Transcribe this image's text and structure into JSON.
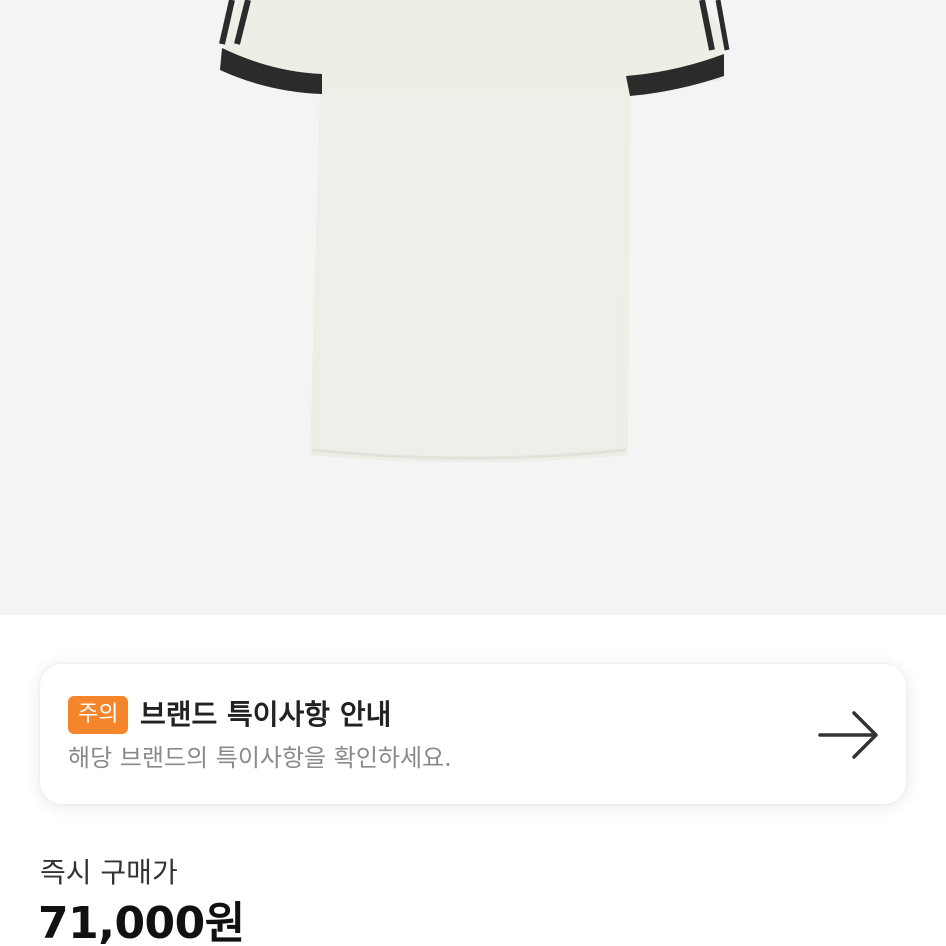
{
  "product": {
    "image_alt": "white t-shirt with black three-stripe sleeves"
  },
  "notice": {
    "badge": "주의",
    "title": "브랜드 특이사항 안내",
    "description": "해당 브랜드의 특이사항을 확인하세요.",
    "arrow_icon": "arrow-right-icon",
    "badge_color": "#f5852a"
  },
  "price": {
    "label": "즉시 구매가",
    "value": "71,000원"
  }
}
